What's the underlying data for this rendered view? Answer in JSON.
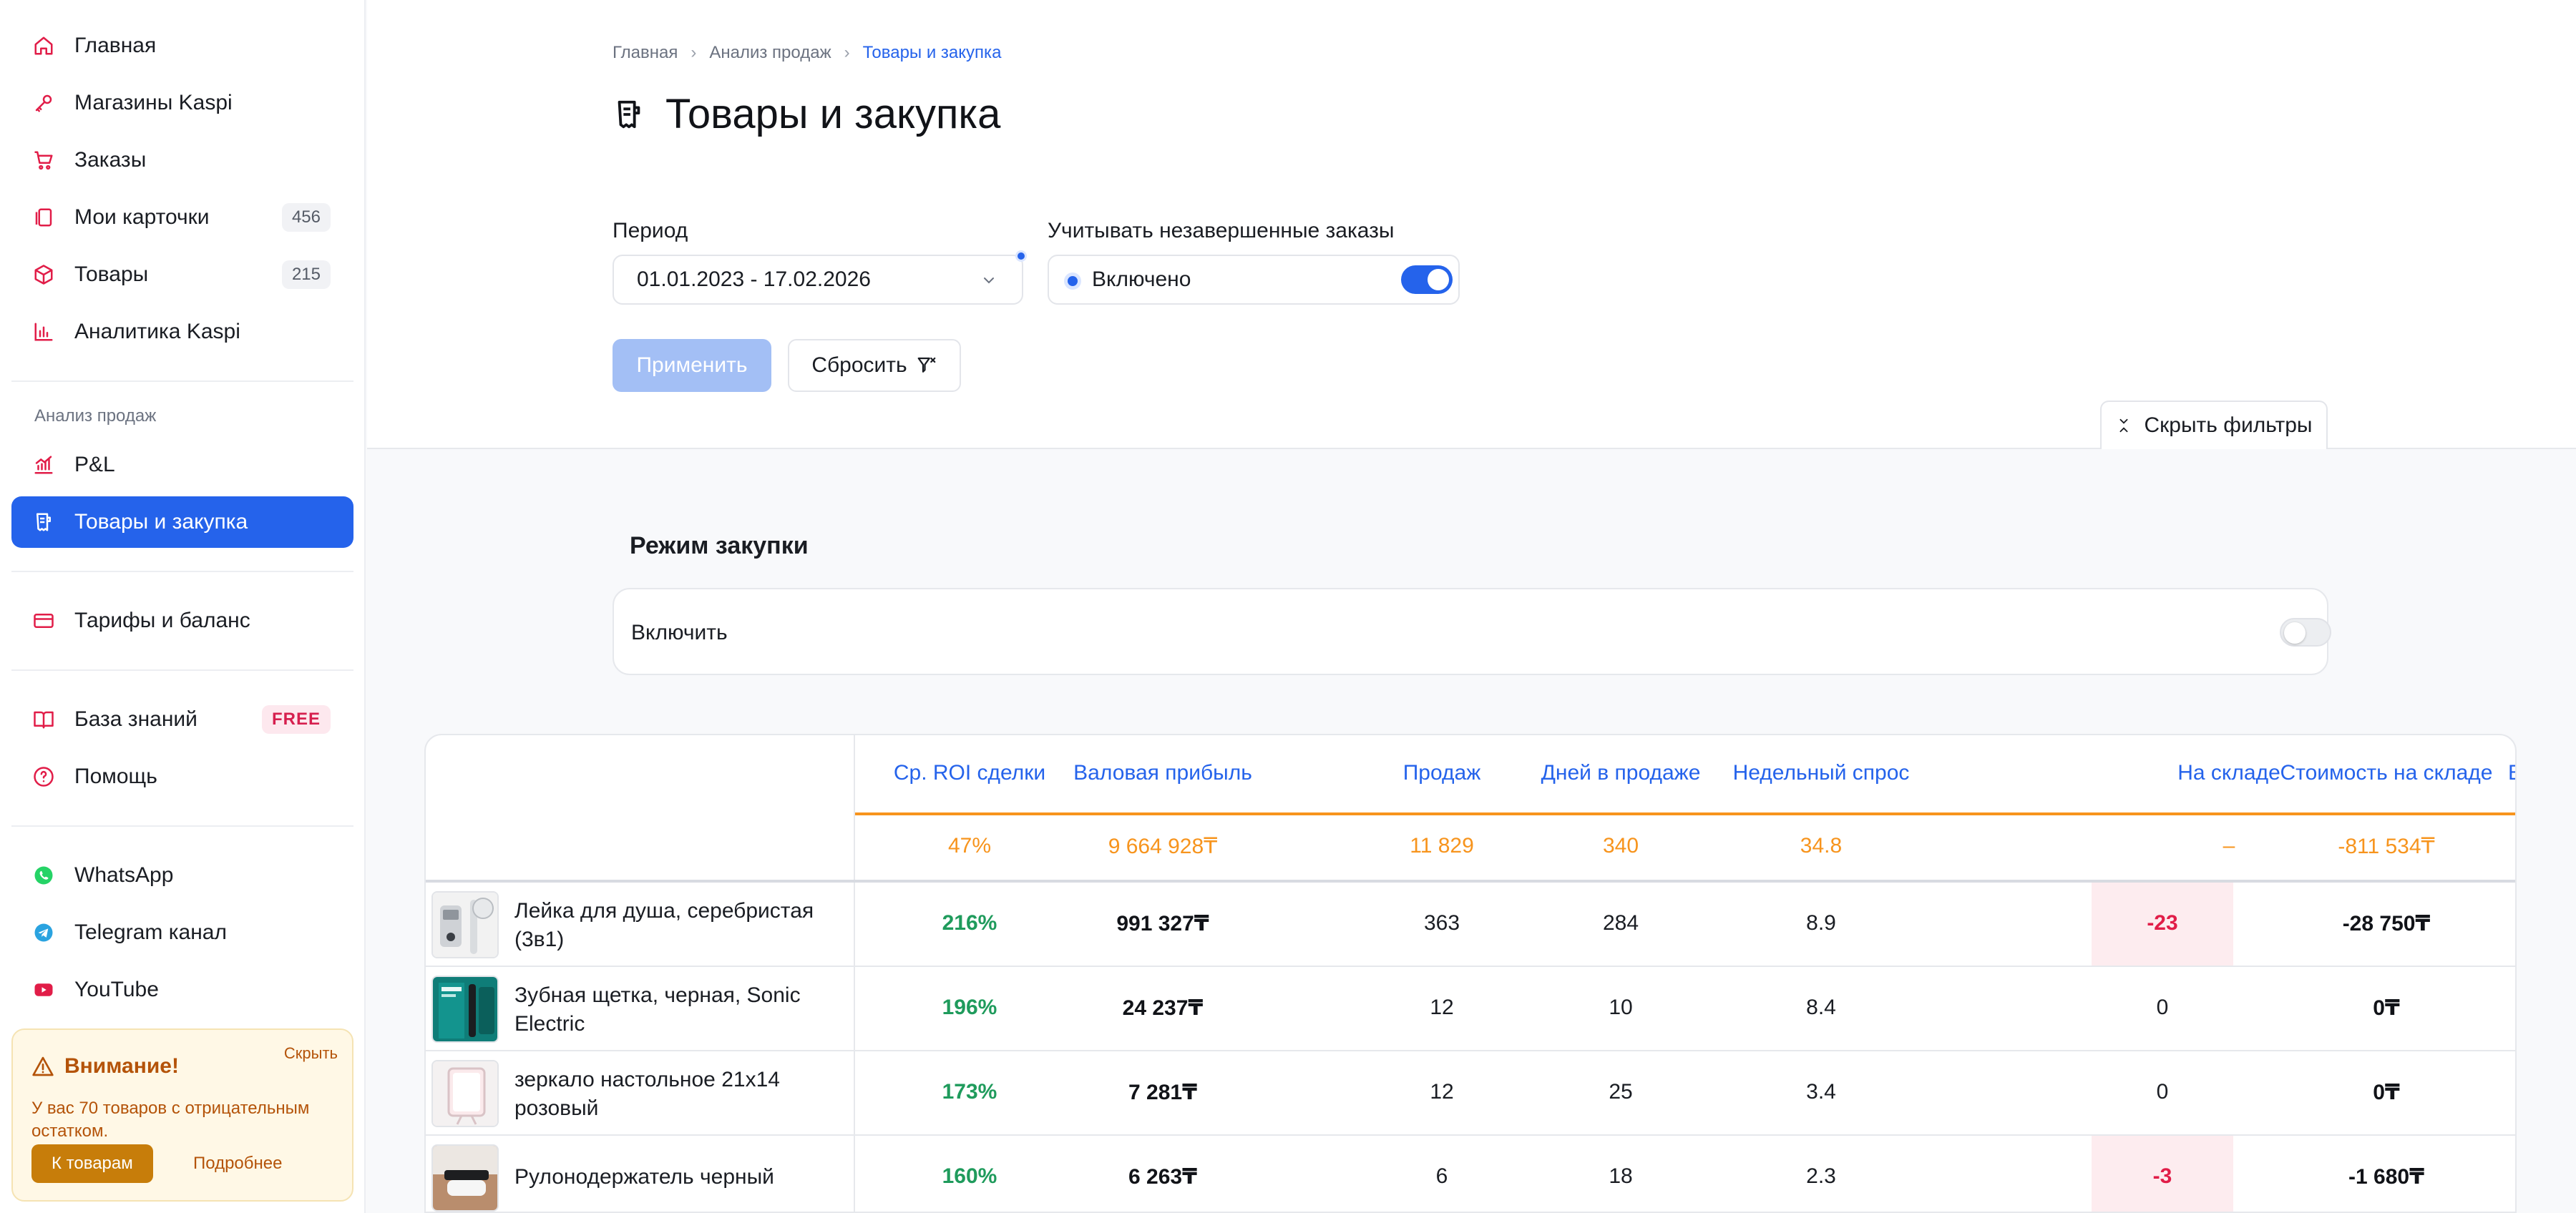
{
  "sidebar": {
    "items": [
      {
        "label": "Главная",
        "icon": "home-icon"
      },
      {
        "label": "Магазины Kaspi",
        "icon": "key-icon"
      },
      {
        "label": "Заказы",
        "icon": "cart-icon"
      },
      {
        "label": "Мои карточки",
        "icon": "cards-icon",
        "badge": "456"
      },
      {
        "label": "Товары",
        "icon": "box-icon",
        "badge": "215"
      },
      {
        "label": "Аналитика Kaspi",
        "icon": "bar-chart-icon"
      }
    ],
    "section_label": "Анализ продаж",
    "analysis_items": [
      {
        "label": "P&L",
        "icon": "pl-chart-icon"
      },
      {
        "label": "Товары и закупка",
        "icon": "receipt-icon",
        "active": true
      }
    ],
    "billing": {
      "label": "Тарифы и баланс",
      "icon": "credit-card-icon"
    },
    "knowledge": {
      "label": "База знаний",
      "icon": "book-icon",
      "badge": "FREE"
    },
    "help": {
      "label": "Помощь",
      "icon": "help-icon"
    },
    "socials": [
      {
        "label": "WhatsApp",
        "icon": "whatsapp-icon"
      },
      {
        "label": "Telegram канал",
        "icon": "telegram-icon"
      },
      {
        "label": "YouTube",
        "icon": "youtube-icon"
      }
    ],
    "alert": {
      "title": "Внимание!",
      "hide": "Скрыть",
      "text": "У вас 70 товаров с отрицательным остатком.",
      "primary": "К товарам",
      "more": "Подробнее"
    }
  },
  "breadcrumb": [
    "Главная",
    "Анализ продаж",
    "Товары и закупка"
  ],
  "page_title": "Товары и закупка",
  "filters": {
    "period_label": "Период",
    "period_value": "01.01.2023 - 17.02.2026",
    "incomplete_label": "Учитывать незавершенные заказы",
    "incomplete_value": "Включено",
    "incomplete_on": true,
    "apply": "Применить",
    "reset": "Сбросить",
    "hide_filters": "Скрыть фильтры"
  },
  "purchase_mode": {
    "title": "Режим закупки",
    "enable_label": "Включить",
    "enabled": false
  },
  "table": {
    "columns": [
      "Ср. ROI сделки",
      "Валовая прибыль",
      "Продаж",
      "Дней в продаже",
      "Недельный спрос",
      "На складе",
      "Стоимость на складе",
      "В"
    ],
    "totals": [
      "47%",
      "9 664 928₸",
      "11 829",
      "340",
      "34.8",
      "–",
      "-811 534₸"
    ],
    "rows": [
      {
        "name": "Лейка для душа, серебристая (3в1)",
        "roi": "216%",
        "profit": "991 327₸",
        "sales": "363",
        "days": "284",
        "demand": "8.9",
        "stock": "-23",
        "stock_value": "-28 750₸"
      },
      {
        "name": "Зубная щетка, черная, Sonic Electric",
        "roi": "196%",
        "profit": "24 237₸",
        "sales": "12",
        "days": "10",
        "demand": "8.4",
        "stock": "0",
        "stock_value": "0₸"
      },
      {
        "name": "зеркало настольное 21х14 розовый",
        "roi": "173%",
        "profit": "7 281₸",
        "sales": "12",
        "days": "25",
        "demand": "3.4",
        "stock": "0",
        "stock_value": "0₸"
      },
      {
        "name": "Рулонодержатель черный",
        "roi": "160%",
        "profit": "6 263₸",
        "sales": "6",
        "days": "18",
        "demand": "2.3",
        "stock": "-3",
        "stock_value": "-1 680₸"
      }
    ]
  },
  "colors": {
    "accent": "#2563eb",
    "totals": "#f7941d",
    "positive": "#1f9b5c",
    "negative": "#e11d48",
    "warning": "#b45309"
  }
}
